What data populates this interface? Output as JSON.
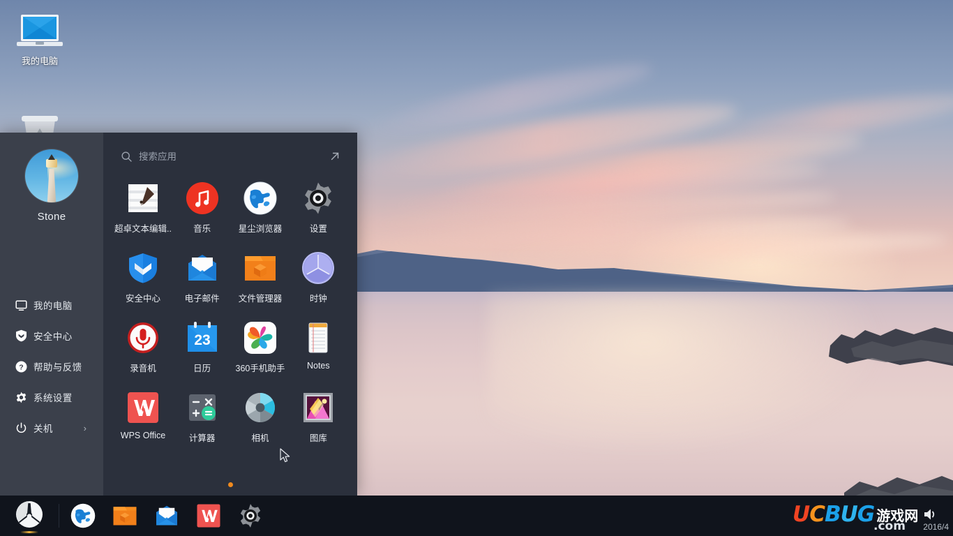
{
  "desktop": {
    "icons": [
      {
        "name": "我的电脑",
        "icon": "computer-icon"
      },
      {
        "name": "",
        "icon": "recycle-bin-icon"
      }
    ]
  },
  "launcher": {
    "user": {
      "name": "Stone",
      "avatar": "lighthouse-avatar"
    },
    "sidebar_items": [
      {
        "label": "我的电脑",
        "icon": "monitor-icon"
      },
      {
        "label": "安全中心",
        "icon": "shield-icon"
      },
      {
        "label": "帮助与反馈",
        "icon": "question-circle-icon"
      },
      {
        "label": "系统设置",
        "icon": "gear-icon"
      },
      {
        "label": "关机",
        "icon": "power-icon",
        "arrow": "›"
      }
    ],
    "search": {
      "placeholder": "搜索应用",
      "value": "",
      "icon": "search-icon"
    },
    "expand_icon": "expand-arrow-icon",
    "apps": [
      {
        "label": "超卓文本编辑..",
        "icon": "text-editor-icon"
      },
      {
        "label": "音乐",
        "icon": "music-icon"
      },
      {
        "label": "星尘浏览器",
        "icon": "browser-globe-icon"
      },
      {
        "label": "设置",
        "icon": "settings-gear-icon"
      },
      {
        "label": "安全中心",
        "icon": "security-shield-icon"
      },
      {
        "label": "电子邮件",
        "icon": "email-envelope-icon"
      },
      {
        "label": "文件管理器",
        "icon": "file-manager-icon"
      },
      {
        "label": "时钟",
        "icon": "clock-icon"
      },
      {
        "label": "录音机",
        "icon": "microphone-icon"
      },
      {
        "label": "日历",
        "icon": "calendar-icon",
        "day": "23"
      },
      {
        "label": "360手机助手",
        "icon": "360-assistant-icon"
      },
      {
        "label": "Notes",
        "icon": "notes-icon"
      },
      {
        "label": "WPS Office",
        "icon": "wps-office-icon"
      },
      {
        "label": "计算器",
        "icon": "calculator-icon"
      },
      {
        "label": "相机",
        "icon": "camera-icon"
      },
      {
        "label": "图库",
        "icon": "gallery-icon"
      }
    ],
    "page_dots": {
      "count": 1,
      "active": 0,
      "color": "#f08a1e"
    }
  },
  "taskbar": {
    "start_icon": "start-menu-icon",
    "pinned": [
      {
        "icon": "browser-globe-icon",
        "label": "星尘浏览器"
      },
      {
        "icon": "file-manager-icon",
        "label": "文件管理器"
      },
      {
        "icon": "email-envelope-icon",
        "label": "电子邮件"
      },
      {
        "icon": "wps-office-icon",
        "label": "WPS Office"
      },
      {
        "icon": "settings-gear-icon",
        "label": "设置"
      }
    ],
    "tray": {
      "volume_icon": "volume-icon"
    }
  },
  "watermark": {
    "u": "U",
    "c": "C",
    "b": "B",
    "u2": "U",
    "g": "G",
    "cn": "游戏网",
    "com": ".com",
    "date": "2016/4"
  },
  "theme": {
    "sidebar_bg": "#3b404b",
    "panel_bg": "#2b303c",
    "taskbar_bg": "#10141c",
    "accent": "#f08a1e"
  }
}
